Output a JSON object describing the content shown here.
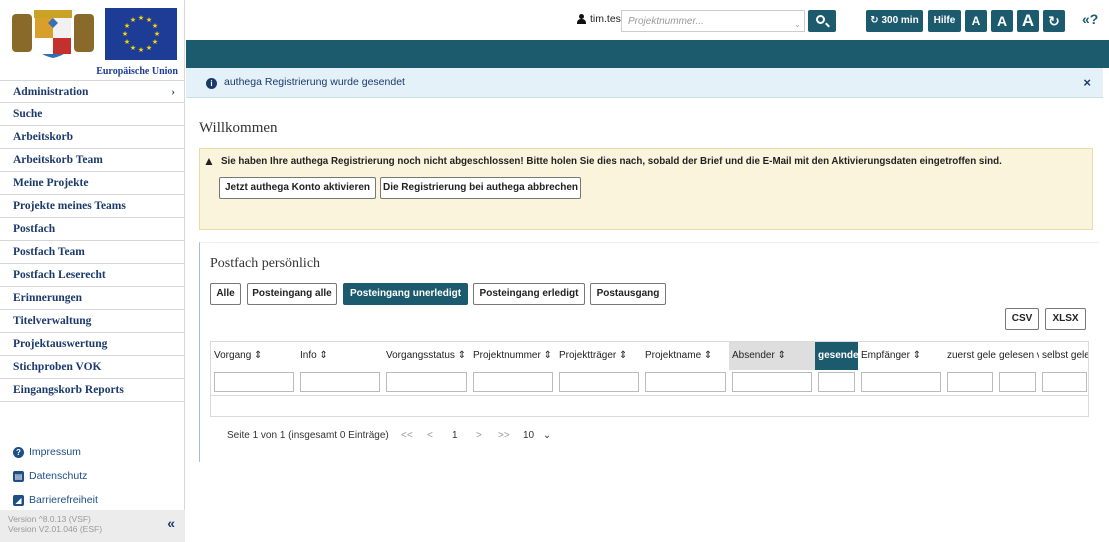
{
  "brand": {
    "eu_caption": "Europäische Union",
    "eu_flag_color": "#1d3c96",
    "primary_color": "#1c5a6e"
  },
  "sidebar": {
    "items": [
      {
        "label": "Administration",
        "icon": "chevron-right-icon"
      },
      {
        "label": "Suche"
      },
      {
        "label": "Arbeitskorb"
      },
      {
        "label": "Arbeitskorb Team"
      },
      {
        "label": "Meine Projekte"
      },
      {
        "label": "Projekte meines Teams"
      },
      {
        "label": "Postfach"
      },
      {
        "label": "Postfach Team"
      },
      {
        "label": "Postfach Leserecht"
      },
      {
        "label": "Erinnerungen"
      },
      {
        "label": "Titelverwaltung"
      },
      {
        "label": "Projektauswertung"
      },
      {
        "label": "Stichproben VOK"
      },
      {
        "label": "Eingangskorb Reports"
      }
    ],
    "footer": [
      {
        "label": "Impressum",
        "icon": "question-circle-icon"
      },
      {
        "label": "Datenschutz",
        "icon": "id-card-icon"
      },
      {
        "label": "Barrierefreiheit",
        "icon": "accessibility-icon"
      }
    ],
    "version_lines": [
      "Version ^8.0.13 (VSF)",
      "Version V2.01.046 (ESF)"
    ],
    "collapse_glyph": "«"
  },
  "topbar": {
    "username": "tim.test",
    "project_placeholder": "Projektnummer...",
    "timer_label": "300 min",
    "help_label": "Hilfe",
    "font_size_label": "A",
    "back_glyph": "«?"
  },
  "notice": {
    "text": "authega Registrierung wurde gesendet",
    "close": "×"
  },
  "main": {
    "title": "Willkommen",
    "warning": {
      "text": "Sie haben Ihre authega Registrierung noch nicht abgeschlossen! Bitte holen Sie dies nach, sobald der Brief und die E-Mail mit den Aktivierungsdaten eingetroffen sind.",
      "activate_label": "Jetzt authega Konto aktivieren",
      "cancel_label": "Die Registrierung bei authega abbrechen"
    }
  },
  "mailbox": {
    "title": "Postfach persönlich",
    "filters": [
      "Alle",
      "Posteingang alle",
      "Posteingang unerledigt",
      "Posteingang erledigt",
      "Postausgang"
    ],
    "active_filter": "Posteingang unerledigt",
    "export_csv": "CSV",
    "export_xlsx": "XLSX",
    "columns": [
      "Vorgang ⇕",
      "Info ⇕",
      "Vorgangsstatus ⇕",
      "Projektnummer ⇕",
      "Projektträger ⇕",
      "Projektname ⇕",
      "Absender ⇕",
      "gesendet",
      "Empfänger ⇕",
      "zuerst gele",
      "gelesen v",
      "selbst geles"
    ],
    "sorted_column": "Absender",
    "active_column": "gesendet",
    "pager": {
      "summary": "Seite 1 von 1 (insgesamt 0 Einträge)",
      "first": "<<",
      "prev": "<",
      "current": "1",
      "next": ">",
      "last": ">>",
      "page_size": "10"
    }
  }
}
